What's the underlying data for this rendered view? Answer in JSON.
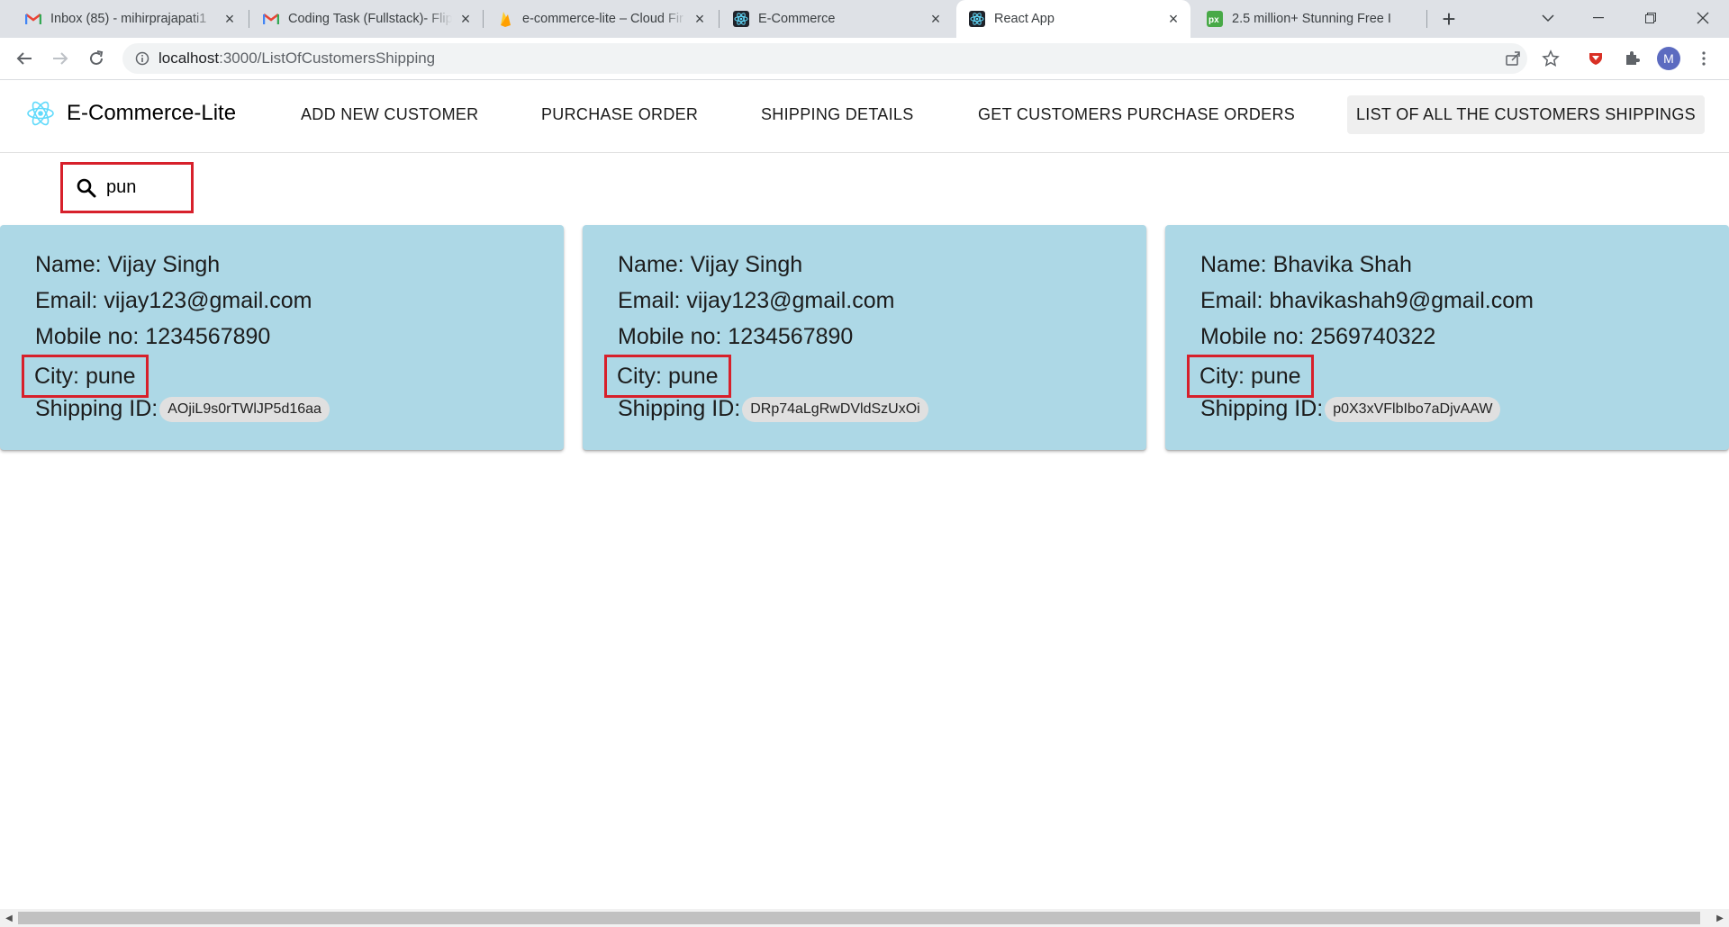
{
  "browser": {
    "tabs": [
      {
        "title": "Inbox (85) - mihirprajapati1",
        "icon": "gmail-icon"
      },
      {
        "title": "Coding Task (Fullstack)- Flip",
        "icon": "gmail-icon"
      },
      {
        "title": "e-commerce-lite – Cloud Fir",
        "icon": "firebase-icon"
      },
      {
        "title": "E-Commerce",
        "icon": "react-icon"
      },
      {
        "title": "React App",
        "icon": "react-icon",
        "active": true
      },
      {
        "title": "2.5 million+ Stunning Free I",
        "icon": "pixabay-icon"
      }
    ],
    "url_host": "localhost",
    "url_path": ":3000/ListOfCustomersShipping",
    "profile_initial": "M"
  },
  "app": {
    "brand": "E-Commerce-Lite",
    "nav": [
      "ADD NEW CUSTOMER",
      "PURCHASE ORDER",
      "SHIPPING DETAILS",
      "GET CUSTOMERS PURCHASE ORDERS",
      "LIST OF ALL THE CUSTOMERS SHIPPINGS"
    ],
    "active_nav": "LIST OF ALL THE CUSTOMERS SHIPPINGS"
  },
  "search": {
    "value": "pun",
    "icon": "search-icon"
  },
  "cards": [
    {
      "name": "Name: Vijay Singh",
      "email": "Email: vijay123@gmail.com",
      "mobile": "Mobile no: 1234567890",
      "city": "City: pune",
      "shipping_label": "Shipping ID:",
      "shipping_id": "AOjiL9s0rTWlJP5d16aa"
    },
    {
      "name": "Name: Vijay Singh",
      "email": "Email: vijay123@gmail.com",
      "mobile": "Mobile no: 1234567890",
      "city": "City: pune",
      "shipping_label": "Shipping ID:",
      "shipping_id": "DRp74aLgRwDVldSzUxOi"
    },
    {
      "name": "Name: Bhavika Shah",
      "email": "Email: bhavikashah9@gmail.com",
      "mobile": "Mobile no: 2569740322",
      "city": "City: pune",
      "shipping_label": "Shipping ID:",
      "shipping_id": "p0X3xVFlbIbo7aDjvAAW"
    }
  ],
  "colors": {
    "card_bg": "#add8e6",
    "highlight": "#d7202b"
  }
}
